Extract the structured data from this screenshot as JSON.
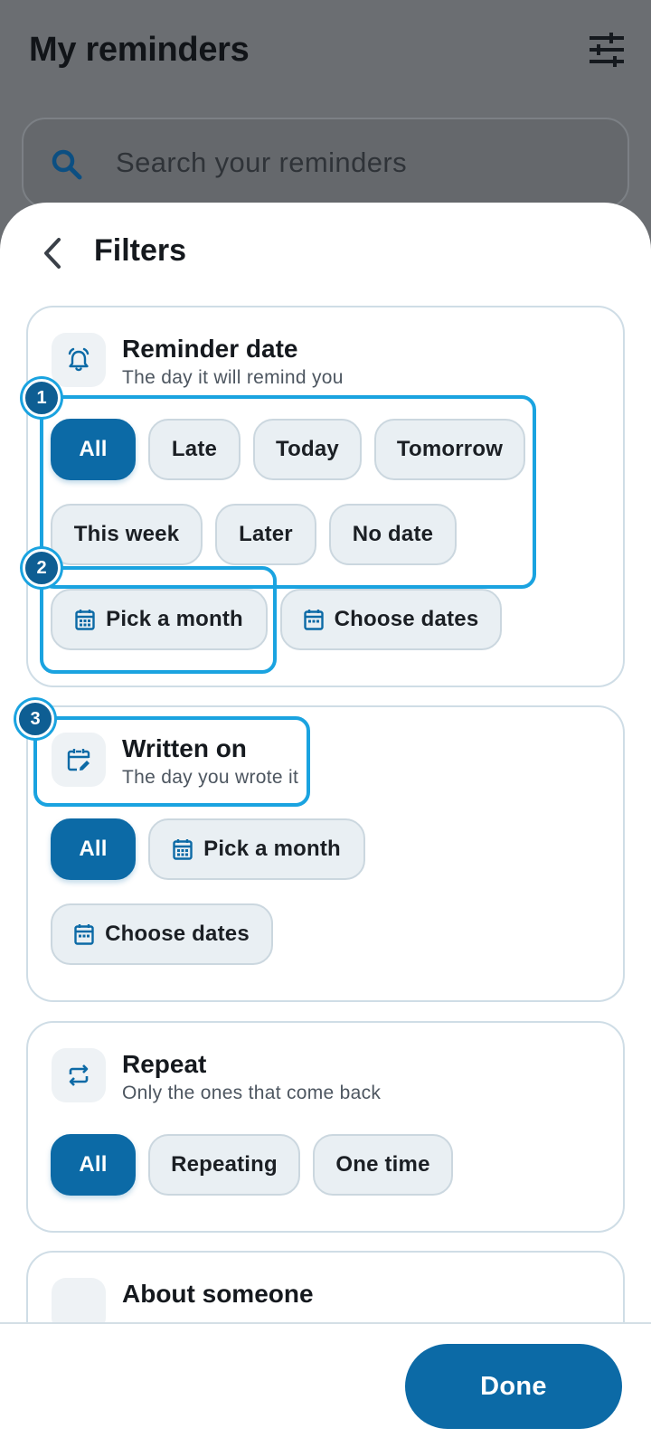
{
  "app": {
    "title": "My reminders",
    "search_placeholder": "Search your reminders"
  },
  "sheet": {
    "title": "Filters"
  },
  "reminder_date": {
    "title": "Reminder date",
    "subtitle": "The day it will remind you",
    "chips": [
      "All",
      "Late",
      "Today",
      "Tomorrow",
      "This week",
      "Later",
      "No date",
      "Pick a month",
      "Choose dates"
    ],
    "selected": "All"
  },
  "written_on": {
    "title": "Written on",
    "subtitle": "The day you wrote it",
    "chips": [
      "All",
      "Pick a month",
      "Choose dates"
    ],
    "selected": "All"
  },
  "repeat": {
    "title": "Repeat",
    "subtitle": "Only the ones that come back",
    "chips": [
      "All",
      "Repeating",
      "One time"
    ],
    "selected": "All"
  },
  "about_someone": {
    "title": "About someone"
  },
  "annotations": {
    "badge_1": "1",
    "badge_2": "2",
    "badge_3": "3"
  },
  "footer": {
    "done_label": "Done"
  },
  "colors": {
    "accent": "#0c6aa6",
    "highlight": "#1aa3e0",
    "chip_bg": "#e9eff3",
    "scrim": "#6b6e72"
  }
}
